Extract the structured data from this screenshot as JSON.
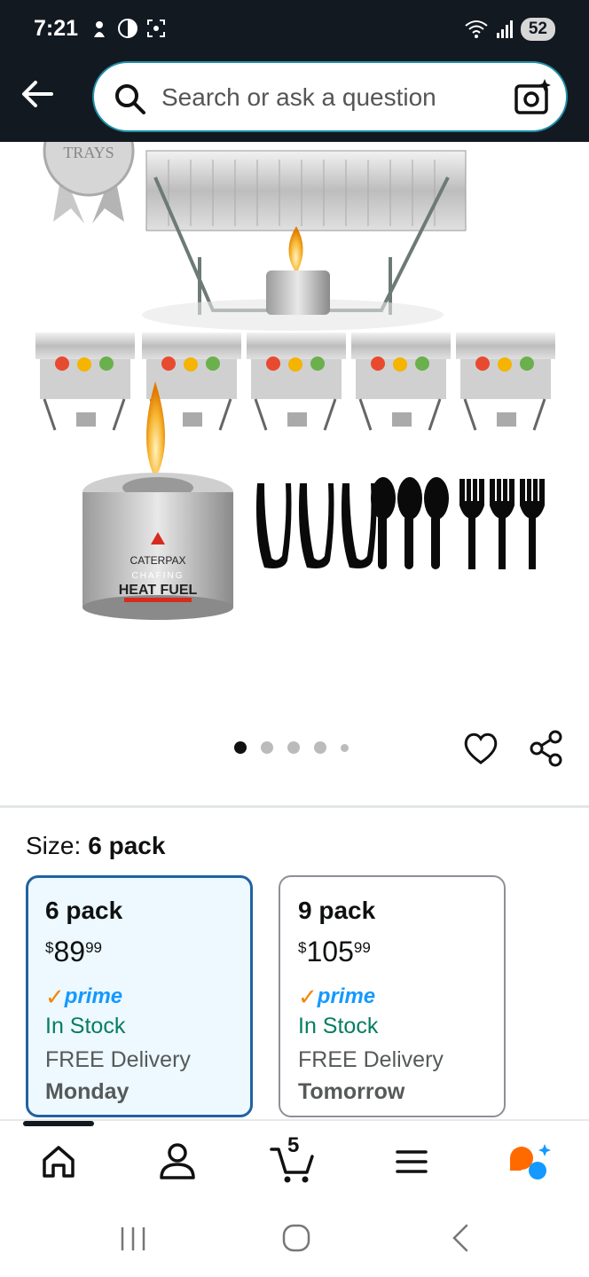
{
  "status_bar": {
    "time": "7:21",
    "battery": "52"
  },
  "search": {
    "placeholder": "Search or ask a question"
  },
  "product_image": {
    "heat_fuel_brand": "CATERPAX",
    "heat_fuel_label": "HEAT FUEL",
    "heat_fuel_sub": "CHAFING",
    "badge_text": "TRAYS"
  },
  "carousel": {
    "total": 5,
    "active": 0
  },
  "size_selector": {
    "label": "Size:",
    "selected": "6 pack",
    "options": [
      {
        "name": "6 pack",
        "currency": "$",
        "whole": "89",
        "fraction": "99",
        "prime": "prime",
        "stock": "In Stock",
        "delivery": "FREE Delivery",
        "day": "Monday",
        "selected": true
      },
      {
        "name": "9 pack",
        "currency": "$",
        "whole": "105",
        "fraction": "99",
        "prime": "prime",
        "stock": "In Stock",
        "delivery": "FREE Delivery",
        "day": "Tomorrow",
        "selected": false
      }
    ]
  },
  "bottom_nav": {
    "cart_count": "5"
  },
  "colors": {
    "header": "#131921",
    "selected_border": "#2162a1",
    "in_stock": "#067d62",
    "prime": "#1399ff",
    "ai_orange": "#ff6a00",
    "ai_blue": "#1399ff"
  }
}
